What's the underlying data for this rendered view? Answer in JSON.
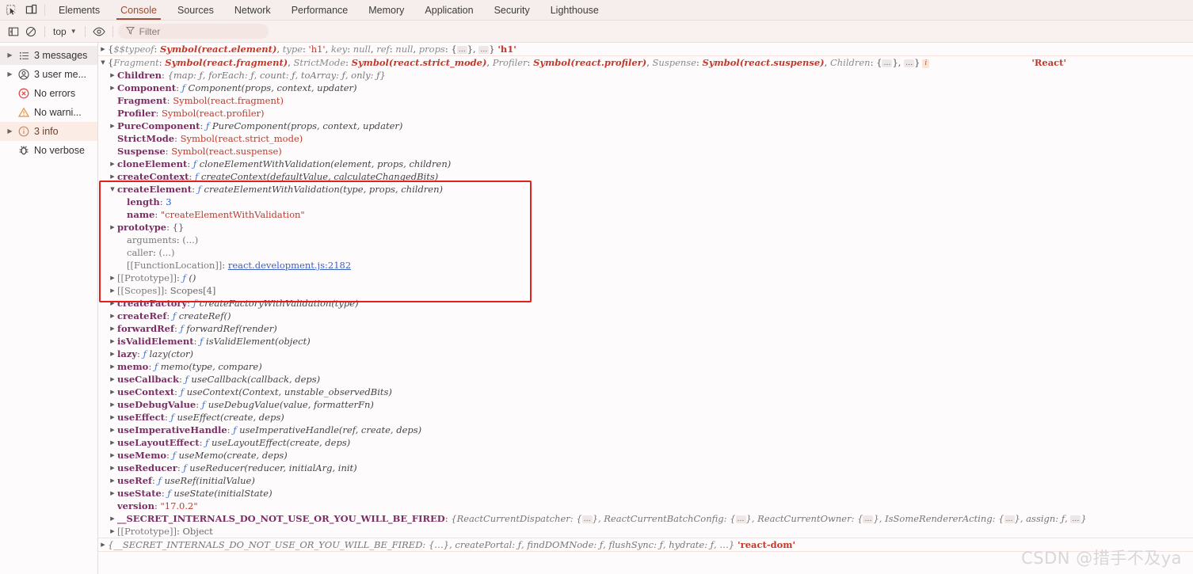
{
  "devtools": {
    "icons": {
      "inspect": "inspect-element-icon",
      "device": "device-toolbar-icon",
      "sidebar": "console-sidebar-toggle-icon",
      "clear": "clear-console-icon",
      "eye": "live-expression-icon",
      "filter": "filter-icon",
      "caret": "chevron-down-icon"
    },
    "tabs": [
      {
        "label": "Elements",
        "active": false
      },
      {
        "label": "Console",
        "active": true
      },
      {
        "label": "Sources",
        "active": false
      },
      {
        "label": "Network",
        "active": false
      },
      {
        "label": "Performance",
        "active": false
      },
      {
        "label": "Memory",
        "active": false
      },
      {
        "label": "Application",
        "active": false
      },
      {
        "label": "Security",
        "active": false
      },
      {
        "label": "Lighthouse",
        "active": false
      }
    ],
    "toolbar": {
      "context": "top",
      "filter_placeholder": "Filter"
    },
    "sidebar": [
      {
        "label": "3 messages",
        "icon": "list-icon",
        "arrow": true,
        "state": "selected"
      },
      {
        "label": "3 user me...",
        "icon": "user-icon",
        "arrow": true,
        "state": "normal"
      },
      {
        "label": "No errors",
        "icon": "error-icon",
        "arrow": false,
        "state": "normal"
      },
      {
        "label": "No warni...",
        "icon": "warning-icon",
        "arrow": false,
        "state": "normal"
      },
      {
        "label": "3 info",
        "icon": "info-icon",
        "arrow": true,
        "state": "info"
      },
      {
        "label": "No verbose",
        "icon": "bug-icon",
        "arrow": false,
        "state": "normal"
      }
    ]
  },
  "console": {
    "message1": {
      "text": "{$$typeof: Symbol(react.element), type: 'h1', key: null, ref: null, props: {…}, …}",
      "tail": "'h1'",
      "parts": {
        "typeof_key": "$$typeof",
        "typeof_val": "Symbol(react.element)",
        "type_key": "type",
        "type_val": "'h1'",
        "key_key": "key",
        "key_val": "null",
        "ref_key": "ref",
        "ref_val": "null",
        "props_key": "props"
      }
    },
    "message2": {
      "header": {
        "fragment_key": "Fragment",
        "fragment_val": "Symbol(react.fragment)",
        "strictmode_key": "StrictMode",
        "strictmode_val": "Symbol(react.strict_mode)",
        "profiler_key": "Profiler",
        "profiler_val": "Symbol(react.profiler)",
        "suspense_key": "Suspense",
        "suspense_val": "Symbol(react.suspense)",
        "children_key": "Children",
        "badge": "i"
      },
      "tail": "'React'",
      "properties": [
        {
          "indent": 1,
          "arrow": true,
          "name": "Children",
          "bold": true,
          "value": "{map: ƒ, forEach: ƒ, count: ƒ, toArray: ƒ, only: ƒ}",
          "kind": "preview"
        },
        {
          "indent": 1,
          "arrow": true,
          "name": "Component",
          "bold": true,
          "value": "ƒ Component(props, context, updater)",
          "kind": "fn"
        },
        {
          "indent": 1,
          "arrow": false,
          "name": "Fragment",
          "bold": true,
          "value": "Symbol(react.fragment)",
          "kind": "sym"
        },
        {
          "indent": 1,
          "arrow": false,
          "name": "Profiler",
          "bold": true,
          "value": "Symbol(react.profiler)",
          "kind": "sym"
        },
        {
          "indent": 1,
          "arrow": true,
          "name": "PureComponent",
          "bold": true,
          "value": "ƒ PureComponent(props, context, updater)",
          "kind": "fn"
        },
        {
          "indent": 1,
          "arrow": false,
          "name": "StrictMode",
          "bold": true,
          "value": "Symbol(react.strict_mode)",
          "kind": "sym"
        },
        {
          "indent": 1,
          "arrow": false,
          "name": "Suspense",
          "bold": true,
          "value": "Symbol(react.suspense)",
          "kind": "sym"
        },
        {
          "indent": 1,
          "arrow": true,
          "name": "cloneElement",
          "bold": true,
          "value": "ƒ cloneElementWithValidation(element, props, children)",
          "kind": "fn"
        },
        {
          "indent": 1,
          "arrow": true,
          "name": "createContext",
          "bold": true,
          "value": "ƒ createContext(defaultValue, calculateChangedBits)",
          "kind": "fn"
        },
        {
          "indent": 1,
          "arrow": "open",
          "name": "createElement",
          "bold": true,
          "value": "ƒ createElementWithValidation(type, props, children)",
          "kind": "fn"
        },
        {
          "indent": 2,
          "arrow": false,
          "name": "length",
          "bold": true,
          "value": "3",
          "kind": "num"
        },
        {
          "indent": 2,
          "arrow": false,
          "name": "name",
          "bold": true,
          "value": "\"createElementWithValidation\"",
          "kind": "str"
        },
        {
          "indent": 1,
          "arrow": true,
          "name": "prototype",
          "bold": true,
          "value": "{}",
          "kind": "obj",
          "sub": true
        },
        {
          "indent": 2,
          "arrow": false,
          "name": "arguments",
          "bold": false,
          "value": "(...)",
          "kind": "dim"
        },
        {
          "indent": 2,
          "arrow": false,
          "name": "caller",
          "bold": false,
          "value": "(...)",
          "kind": "dim"
        },
        {
          "indent": 2,
          "arrow": false,
          "name": "[[FunctionLocation]]",
          "bold": false,
          "value": "react.development.js:2182",
          "kind": "link"
        },
        {
          "indent": 1,
          "arrow": true,
          "name": "[[Prototype]]",
          "bold": false,
          "value": "ƒ ()",
          "kind": "fn",
          "sub": true
        },
        {
          "indent": 1,
          "arrow": true,
          "name": "[[Scopes]]",
          "bold": false,
          "value": "Scopes[4]",
          "kind": "scopes",
          "sub": true
        },
        {
          "indent": 1,
          "arrow": true,
          "name": "createFactory",
          "bold": true,
          "value": "ƒ createFactoryWithValidation(type)",
          "kind": "fn"
        },
        {
          "indent": 1,
          "arrow": true,
          "name": "createRef",
          "bold": true,
          "value": "ƒ createRef()",
          "kind": "fn"
        },
        {
          "indent": 1,
          "arrow": true,
          "name": "forwardRef",
          "bold": true,
          "value": "ƒ forwardRef(render)",
          "kind": "fn"
        },
        {
          "indent": 1,
          "arrow": true,
          "name": "isValidElement",
          "bold": true,
          "value": "ƒ isValidElement(object)",
          "kind": "fn"
        },
        {
          "indent": 1,
          "arrow": true,
          "name": "lazy",
          "bold": true,
          "value": "ƒ lazy(ctor)",
          "kind": "fn"
        },
        {
          "indent": 1,
          "arrow": true,
          "name": "memo",
          "bold": true,
          "value": "ƒ memo(type, compare)",
          "kind": "fn"
        },
        {
          "indent": 1,
          "arrow": true,
          "name": "useCallback",
          "bold": true,
          "value": "ƒ useCallback(callback, deps)",
          "kind": "fn"
        },
        {
          "indent": 1,
          "arrow": true,
          "name": "useContext",
          "bold": true,
          "value": "ƒ useContext(Context, unstable_observedBits)",
          "kind": "fn"
        },
        {
          "indent": 1,
          "arrow": true,
          "name": "useDebugValue",
          "bold": true,
          "value": "ƒ useDebugValue(value, formatterFn)",
          "kind": "fn"
        },
        {
          "indent": 1,
          "arrow": true,
          "name": "useEffect",
          "bold": true,
          "value": "ƒ useEffect(create, deps)",
          "kind": "fn"
        },
        {
          "indent": 1,
          "arrow": true,
          "name": "useImperativeHandle",
          "bold": true,
          "value": "ƒ useImperativeHandle(ref, create, deps)",
          "kind": "fn"
        },
        {
          "indent": 1,
          "arrow": true,
          "name": "useLayoutEffect",
          "bold": true,
          "value": "ƒ useLayoutEffect(create, deps)",
          "kind": "fn"
        },
        {
          "indent": 1,
          "arrow": true,
          "name": "useMemo",
          "bold": true,
          "value": "ƒ useMemo(create, deps)",
          "kind": "fn"
        },
        {
          "indent": 1,
          "arrow": true,
          "name": "useReducer",
          "bold": true,
          "value": "ƒ useReducer(reducer, initialArg, init)",
          "kind": "fn"
        },
        {
          "indent": 1,
          "arrow": true,
          "name": "useRef",
          "bold": true,
          "value": "ƒ useRef(initialValue)",
          "kind": "fn"
        },
        {
          "indent": 1,
          "arrow": true,
          "name": "useState",
          "bold": true,
          "value": "ƒ useState(initialState)",
          "kind": "fn"
        },
        {
          "indent": 1,
          "arrow": false,
          "name": "version",
          "bold": true,
          "value": "\"17.0.2\"",
          "kind": "str"
        },
        {
          "indent": 1,
          "arrow": true,
          "name": "__SECRET_INTERNALS_DO_NOT_USE_OR_YOU_WILL_BE_FIRED",
          "bold": true,
          "value": "{ReactCurrentDispatcher: {…}, ReactCurrentBatchConfig: {…}, ReactCurrentOwner: {…}, IsSomeRendererActing: {…}, assign: ƒ, …}",
          "kind": "preview"
        },
        {
          "indent": 1,
          "arrow": true,
          "name": "[[Prototype]]",
          "bold": false,
          "value": "Object",
          "kind": "proto"
        }
      ]
    },
    "message3": {
      "text": "{__SECRET_INTERNALS_DO_NOT_USE_OR_YOU_WILL_BE_FIRED: {…}, createPortal: ƒ, findDOMNode: ƒ, flushSync: ƒ, hydrate: ƒ, …}",
      "tail": "'react-dom'"
    }
  },
  "annotation": {
    "highlight_color": "#e4201e"
  },
  "watermark": "CSDN @措手不及ya"
}
